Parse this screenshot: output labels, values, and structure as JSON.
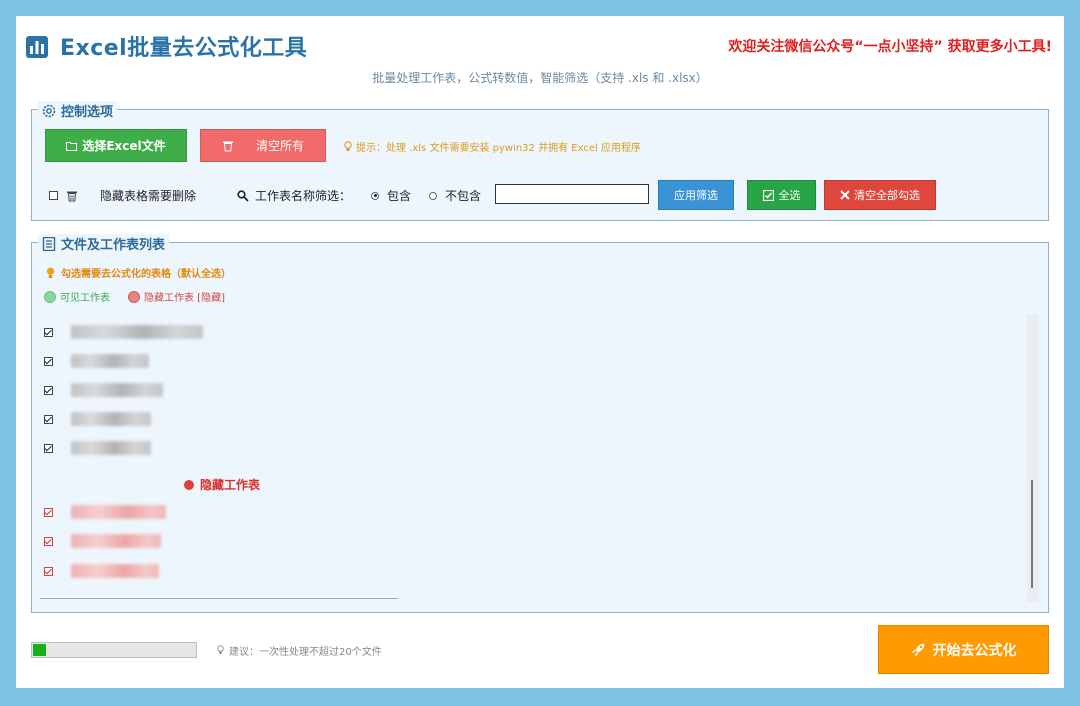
{
  "header": {
    "title": "Excel批量去公式化工具",
    "promo": "欢迎关注微信公众号“一点小坚持” 获取更多小工具!",
    "subtitle": "批量处理工作表，公式转数值，智能筛选（支持 .xls 和 .xlsx）"
  },
  "controls": {
    "legend": "控制选项",
    "select_button": "选择Excel文件",
    "clear_all_button": "清空所有",
    "hint": "提示：处理 .xls 文件需要安装 pywin32 并拥有 Excel 应用程序",
    "hidden_delete_label": "隐藏表格需要删除",
    "hidden_delete_checked": false,
    "filter_label": "工作表名称筛选：",
    "radio_include": "包含",
    "radio_exclude": "不包含",
    "radio_selected": "包含",
    "filter_value": "",
    "apply_filter_button": "应用筛选",
    "select_all_button": "全选",
    "clear_checks_button": "清空全部勾选"
  },
  "file_list": {
    "legend": "文件及工作表列表",
    "tip": "勾选需要去公式化的表格（默认全选）",
    "legend_visible": "可见工作表",
    "legend_hidden": "隐藏工作表 [隐藏]",
    "visible_sheets": [
      {
        "checked": true,
        "label": "[redacted]"
      },
      {
        "checked": true,
        "label": "[redacted]"
      },
      {
        "checked": true,
        "label": "[redacted]"
      },
      {
        "checked": true,
        "label": "[redacted]"
      },
      {
        "checked": true,
        "label": "[redacted]"
      }
    ],
    "hidden_header": "隐藏工作表",
    "hidden_sheets": [
      {
        "checked": true,
        "label": "[redacted]"
      },
      {
        "checked": true,
        "label": "[redacted]"
      },
      {
        "checked": true,
        "label": "[redacted]"
      }
    ]
  },
  "footer": {
    "progress": 0.08,
    "suggestion": "建议：一次性处理不超过20个文件",
    "start_button": "开始去公式化"
  },
  "colors": {
    "title_blue": "#2a73a8",
    "promo_red": "#e02020",
    "visible_dot": "#8fd5a2",
    "hidden_dot": "#e8837d",
    "start_orange": "#ff9a00",
    "progress_green": "#16b01c"
  }
}
